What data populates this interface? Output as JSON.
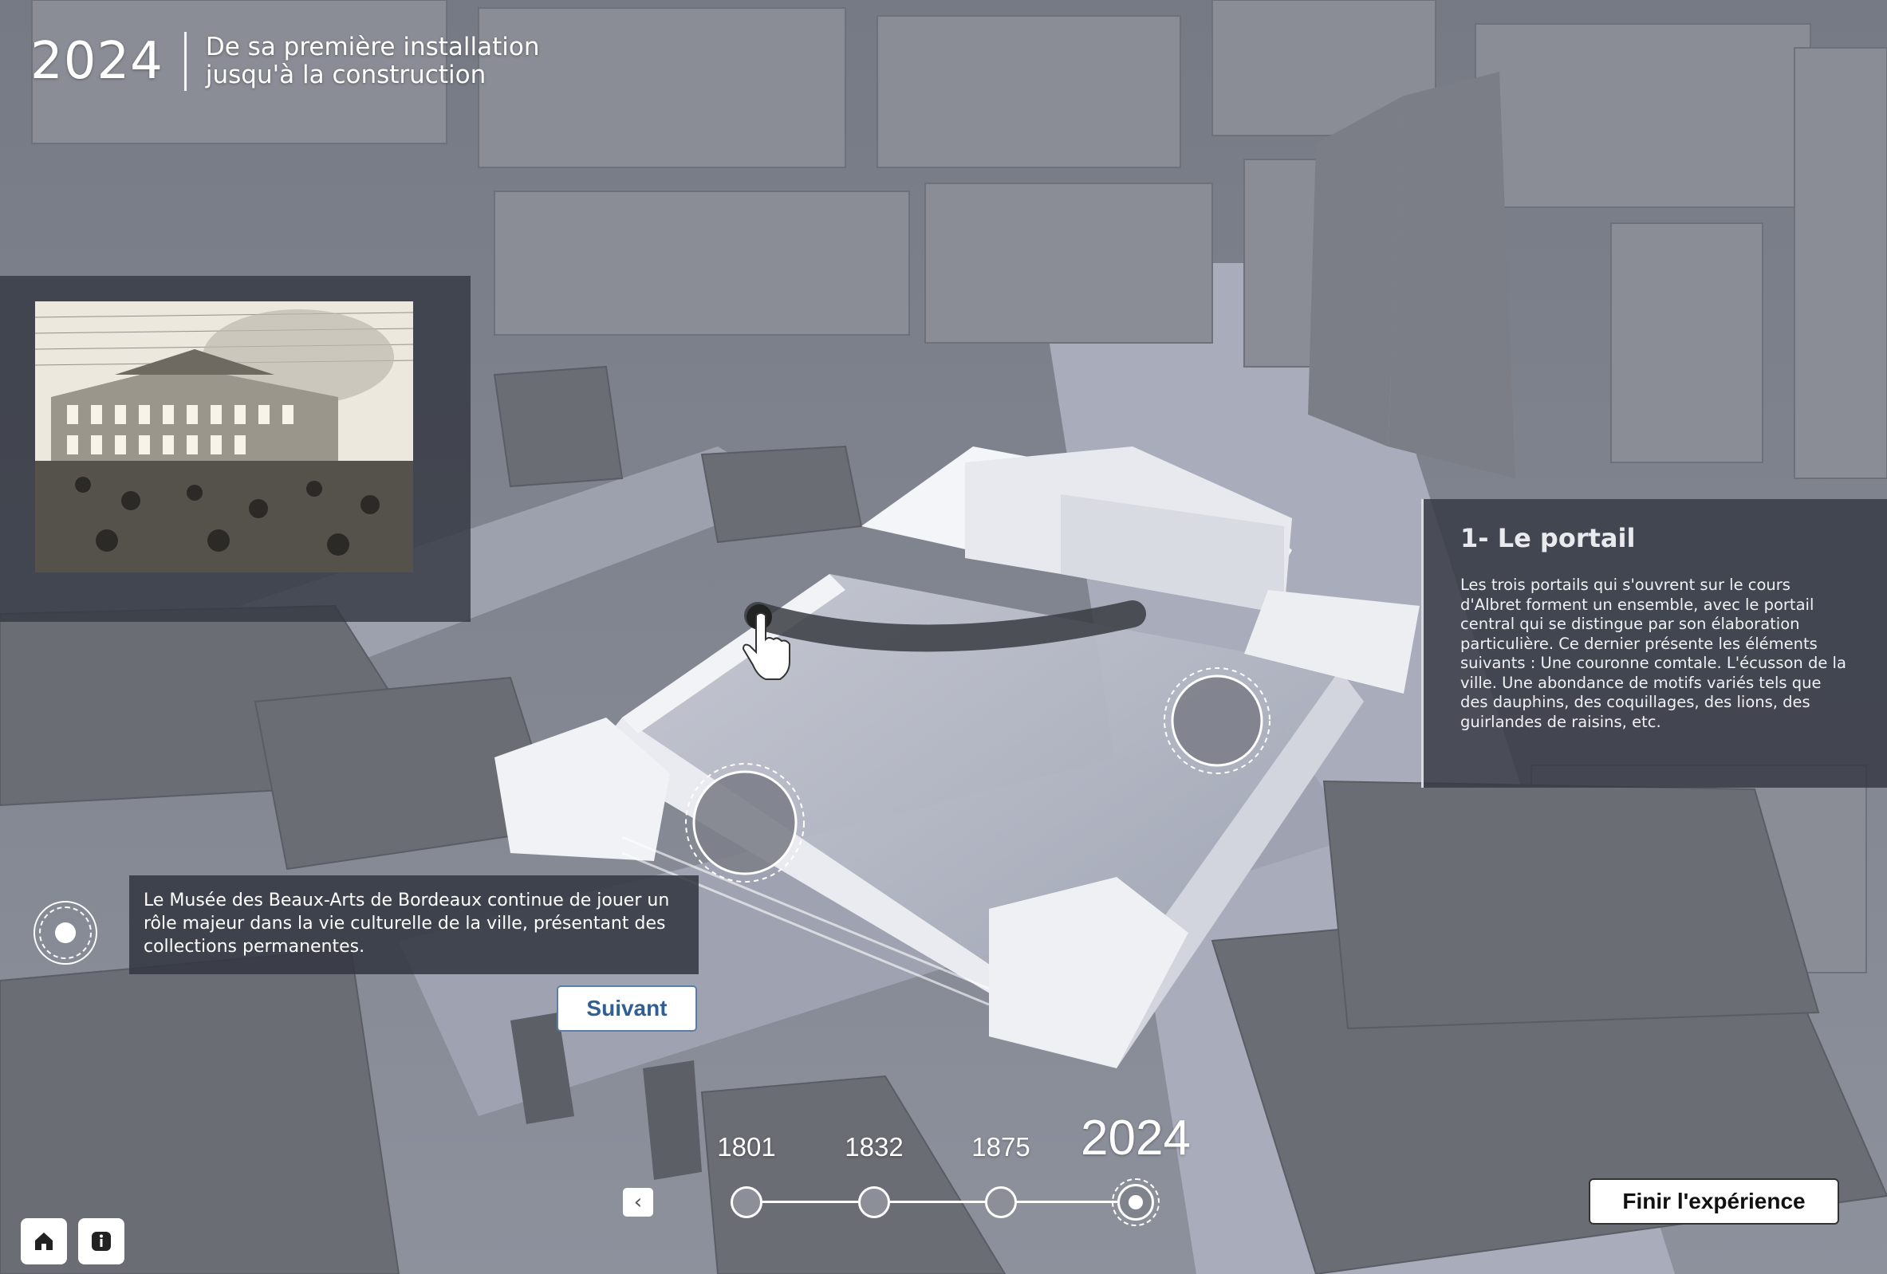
{
  "header": {
    "year": "2024",
    "subtitle_line1": "De sa première installation",
    "subtitle_line2": "jusqu'à la construction"
  },
  "info": {
    "title": "1- Le portail",
    "body": "Les trois portails qui s'ouvrent sur le cours d'Albret forment un ensemble, avec le portail central qui se distingue par son élaboration particulière. Ce dernier présente les éléments suivants : Une couronne comtale. L'écusson de la ville. Une abondance de motifs variés tels que des dauphins, des coquillages, des lions, des guirlandes de raisins, etc."
  },
  "caption": {
    "text": "Le Musée des Beaux-Arts de Bordeaux continue de jouer un rôle majeur dans la vie culturelle de la ville, présentant des collections permanentes."
  },
  "buttons": {
    "next": "Suivant",
    "finish": "Finir l'expérience",
    "prev_glyph": "‹"
  },
  "timeline": {
    "years": [
      "1801",
      "1832",
      "1875",
      "2024"
    ],
    "active_index": 3
  },
  "icons": {
    "home": "home-icon",
    "info": "info-icon",
    "hotspot": "hotspot-marker-icon",
    "hand": "hand-pointer-icon"
  },
  "colors": {
    "panel": "#343842",
    "accent_button_text": "#2f5f93",
    "background": "#6f7480"
  }
}
